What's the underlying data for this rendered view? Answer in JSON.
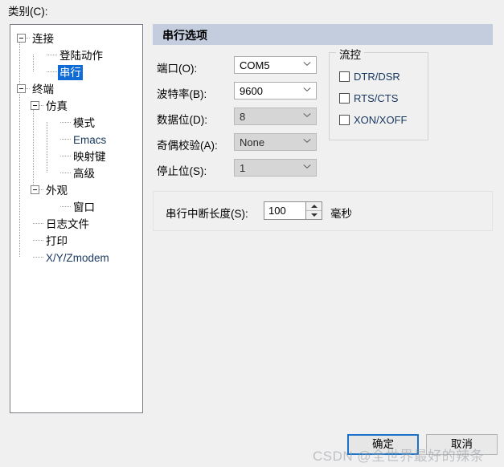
{
  "dialog": {
    "category_label": "类别(C):",
    "watermark": "CSDN @全世界最好的辣条",
    "buttons": {
      "ok": "确定",
      "cancel": "取消"
    },
    "accent_color": "#0f6cd6",
    "header_color": "#c3cdde"
  },
  "tree": {
    "items": [
      {
        "label": "连接",
        "level": 0,
        "expander": "collapse",
        "selected": false
      },
      {
        "label": "登陆动作",
        "level": 2,
        "expander": "none",
        "selected": false
      },
      {
        "label": "串行",
        "level": 2,
        "expander": "none",
        "selected": true
      },
      {
        "label": "终端",
        "level": 0,
        "expander": "collapse",
        "selected": false
      },
      {
        "label": "仿真",
        "level": 1,
        "expander": "collapse",
        "selected": false
      },
      {
        "label": "模式",
        "level": 3,
        "expander": "none",
        "selected": false
      },
      {
        "label": "Emacs",
        "level": 3,
        "expander": "none",
        "selected": false
      },
      {
        "label": "映射键",
        "level": 3,
        "expander": "none",
        "selected": false
      },
      {
        "label": "高级",
        "level": 3,
        "expander": "none",
        "selected": false
      },
      {
        "label": "外观",
        "level": 1,
        "expander": "collapse",
        "selected": false
      },
      {
        "label": "窗口",
        "level": 3,
        "expander": "none",
        "selected": false
      },
      {
        "label": "日志文件",
        "level": 1,
        "expander": "none",
        "selected": false
      },
      {
        "label": "打印",
        "level": 1,
        "expander": "none",
        "selected": false
      },
      {
        "label": "X/Y/Zmodem",
        "level": 1,
        "expander": "none",
        "selected": false
      }
    ]
  },
  "panel": {
    "title": "串行选项",
    "fields": [
      {
        "label": "端口(O):",
        "value": "COM5",
        "disabled": false,
        "name": "port"
      },
      {
        "label": "波特率(B):",
        "value": "9600",
        "disabled": false,
        "name": "baud-rate"
      },
      {
        "label": "数据位(D):",
        "value": "8",
        "disabled": true,
        "name": "data-bits"
      },
      {
        "label": "奇偶校验(A):",
        "value": "None",
        "disabled": true,
        "name": "parity"
      },
      {
        "label": "停止位(S):",
        "value": "1",
        "disabled": true,
        "name": "stop-bits"
      }
    ],
    "flow_control": {
      "legend": "流控",
      "options": [
        {
          "label": "DTR/DSR",
          "checked": false,
          "name": "dtr-dsr"
        },
        {
          "label": "RTS/CTS",
          "checked": false,
          "name": "rts-cts"
        },
        {
          "label": "XON/XOFF",
          "checked": false,
          "name": "xon-xoff"
        }
      ]
    },
    "break_length": {
      "label": "串行中断长度(S):",
      "value": "100",
      "unit": "毫秒"
    }
  }
}
